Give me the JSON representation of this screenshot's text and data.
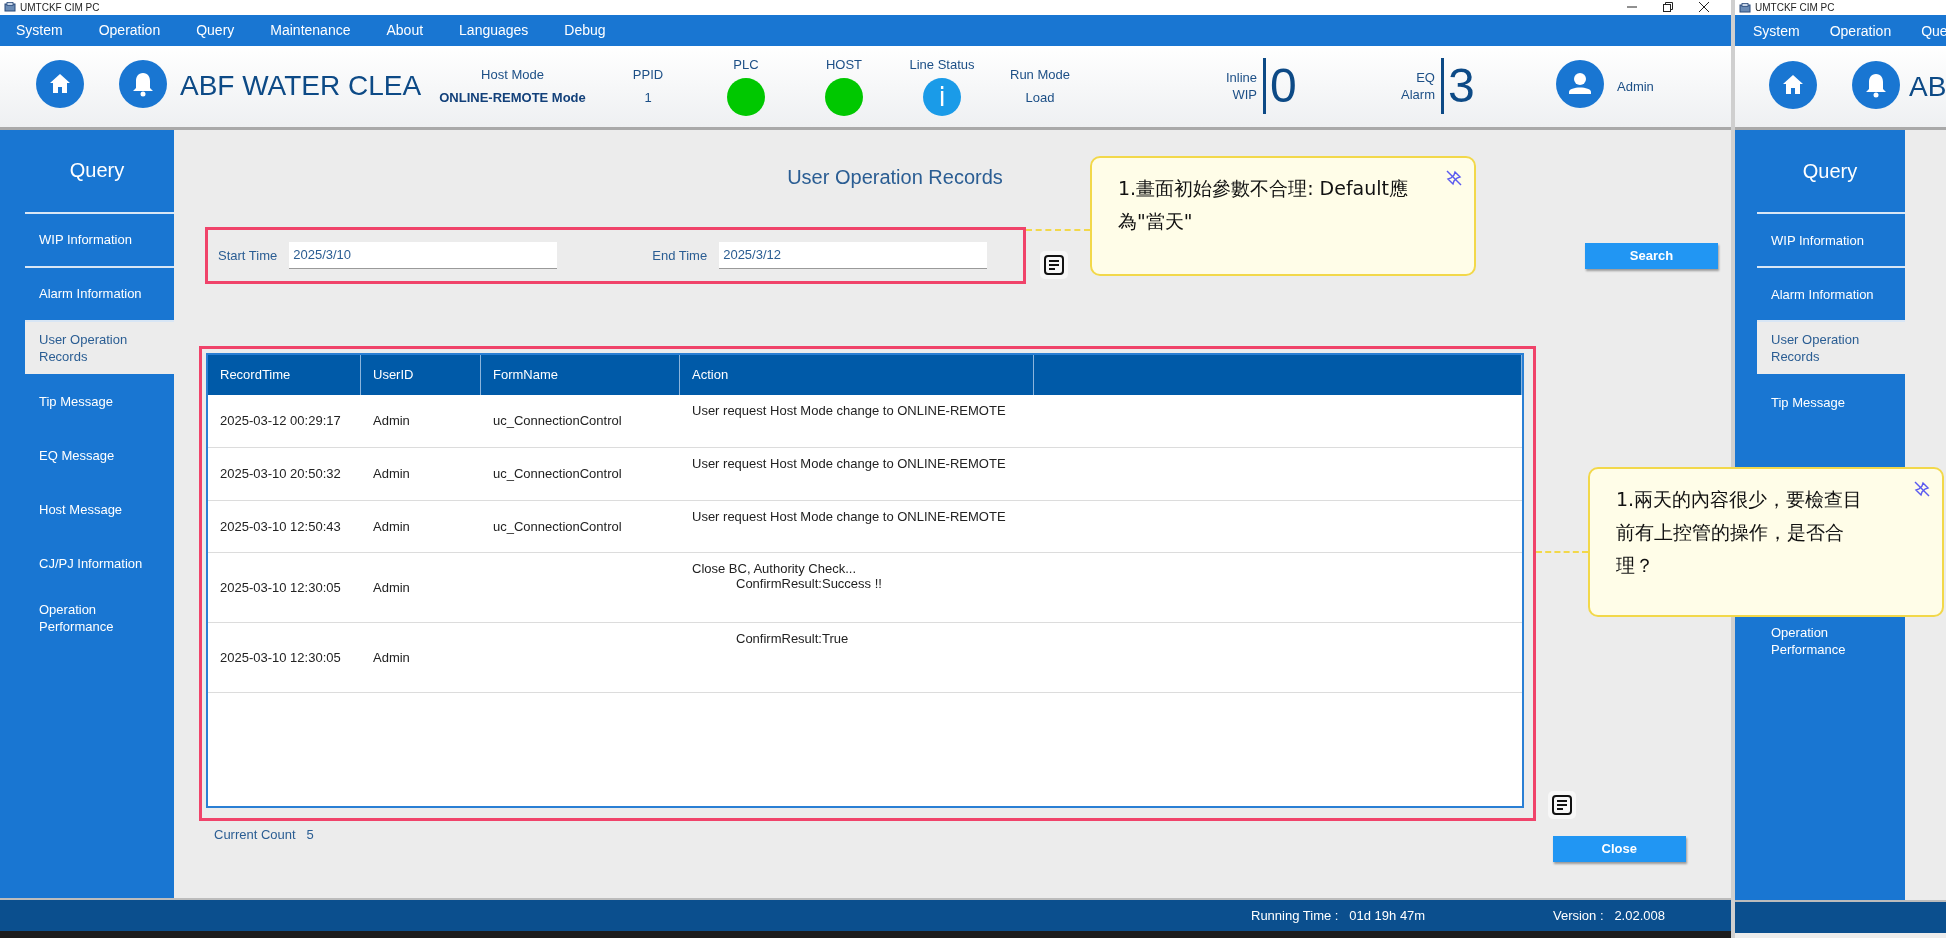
{
  "window": {
    "title": "UMTCKF CIM PC"
  },
  "menu": [
    "System",
    "Operation",
    "Query",
    "Maintenance",
    "About",
    "Languages",
    "Debug"
  ],
  "header": {
    "title": "ABF WATER CLEA",
    "status_items": [
      {
        "kind": "text",
        "label": "Host Mode",
        "value": "ONLINE-REMOTE Mode"
      },
      {
        "kind": "text",
        "label": "PPID",
        "value": "1"
      },
      {
        "kind": "lamp",
        "label": "PLC",
        "color": "#00c800"
      },
      {
        "kind": "lamp",
        "label": "HOST",
        "color": "#00c800"
      },
      {
        "kind": "info",
        "label": "Line Status",
        "color": "#1a9be8",
        "glyph": "i"
      },
      {
        "kind": "text",
        "label": "Run Mode",
        "value": "Load"
      }
    ],
    "counters": [
      {
        "label_lines": [
          "Inline",
          "WIP"
        ],
        "value": "0"
      },
      {
        "label_lines": [
          "EQ",
          "Alarm"
        ],
        "value": "3"
      }
    ],
    "user": "Admin"
  },
  "sidebar": {
    "title": "Query",
    "items": [
      {
        "label": "WIP Information",
        "selected": false
      },
      {
        "label": "Alarm Information",
        "selected": false
      },
      {
        "label": "User Operation Records",
        "selected": true
      },
      {
        "label": "Tip Message",
        "selected": false
      },
      {
        "label": "EQ Message",
        "selected": false
      },
      {
        "label": "Host Message",
        "selected": false
      },
      {
        "label": "CJ/PJ Information",
        "selected": false
      },
      {
        "label": "Operation Performance",
        "selected": false
      }
    ]
  },
  "page": {
    "title": "User Operation Records",
    "filters": [
      {
        "label": "Start Time",
        "value": "2025/3/10"
      },
      {
        "label": "End Time",
        "value": "2025/3/12"
      }
    ],
    "search_button": "Search",
    "table": {
      "columns": [
        "RecordTime",
        "UserID",
        "FormName",
        "Action"
      ],
      "rows": [
        {
          "record_time": "2025-03-12 00:29:17",
          "user_id": "Admin",
          "form_name": "uc_ConnectionControl",
          "action": [
            {
              "text": "User request Host Mode change to ONLINE-REMOTE",
              "indent": false
            }
          ]
        },
        {
          "record_time": "2025-03-10 20:50:32",
          "user_id": "Admin",
          "form_name": "uc_ConnectionControl",
          "action": [
            {
              "text": "User request Host Mode change to ONLINE-REMOTE",
              "indent": false
            }
          ]
        },
        {
          "record_time": "2025-03-10 12:50:43",
          "user_id": "Admin",
          "form_name": "uc_ConnectionControl",
          "action": [
            {
              "text": "User request Host Mode change to ONLINE-REMOTE",
              "indent": false
            }
          ]
        },
        {
          "record_time": "2025-03-10 12:30:05",
          "user_id": "Admin",
          "action": [
            {
              "text": "Close BC, Authority Check...",
              "indent": false
            },
            {
              "text": "ConfirmResult:Success !!",
              "indent": true
            }
          ]
        },
        {
          "record_time": "2025-03-10 12:30:05",
          "user_id": "Admin",
          "action": [
            {
              "text": "ConfirmResult:True",
              "indent": true
            }
          ]
        }
      ]
    },
    "current_count": {
      "label": "Current Count",
      "value": "5"
    },
    "close_button": "Close"
  },
  "status_bar": {
    "running_time": {
      "label": "Running Time :",
      "value": "01d 19h 47m"
    },
    "version": {
      "label": "Version :",
      "value": "2.02.008"
    }
  },
  "notes": [
    {
      "text": "1.畫面初始參數不合理: Default應為\"當天\""
    },
    {
      "text": "1.兩天的內容很少，要檢查目前有上控管的操作，是否合理？"
    }
  ],
  "second_window": {
    "title": "UMTCKF CIM PC",
    "menu": [
      "System",
      "Operation",
      "Que"
    ],
    "header_title": "AB",
    "sidebar": {
      "title": "Query",
      "items": [
        {
          "label": "WIP Information",
          "selected": false
        },
        {
          "label": "Alarm Information",
          "selected": false
        },
        {
          "label": "User Operation Records",
          "selected": true
        },
        {
          "label": "Tip Message",
          "selected": false
        },
        {
          "label": "Operation Performance",
          "selected": false
        }
      ]
    }
  }
}
